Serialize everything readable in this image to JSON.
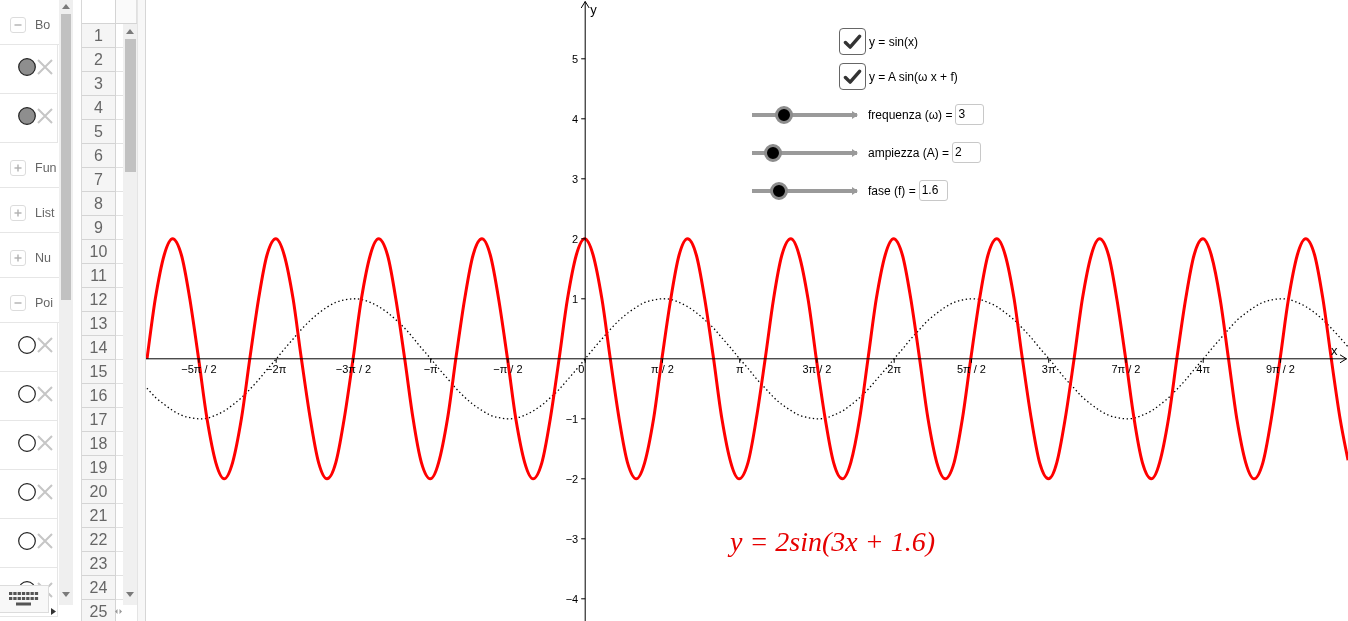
{
  "algebra": {
    "groups": [
      {
        "label": "Bo",
        "expanded": true,
        "items": [
          {
            "visible": true
          },
          {
            "visible": true
          }
        ]
      },
      {
        "label": "Fun",
        "expanded": false
      },
      {
        "label": "List",
        "expanded": false
      },
      {
        "label": "Nu",
        "expanded": false
      },
      {
        "label": "Poi",
        "expanded": true,
        "items": [
          {
            "visible": false
          },
          {
            "visible": false
          },
          {
            "visible": false
          },
          {
            "visible": false
          },
          {
            "visible": false
          },
          {
            "visible": false
          }
        ]
      }
    ]
  },
  "spreadsheet": {
    "row_numbers": [
      "1",
      "2",
      "3",
      "4",
      "5",
      "6",
      "7",
      "8",
      "9",
      "10",
      "11",
      "12",
      "13",
      "14",
      "15",
      "16",
      "17",
      "18",
      "19",
      "20",
      "21",
      "22",
      "23",
      "24",
      "25"
    ]
  },
  "graph": {
    "checkboxes": [
      {
        "label": "y = sin(x)",
        "checked": true
      },
      {
        "label": "y = A sin(ω x + f)",
        "checked": true
      }
    ],
    "sliders": [
      {
        "label": "frequenza (ω) =",
        "value": "3",
        "level": 0.3
      },
      {
        "label": "ampiezza (A) =",
        "value": "2",
        "level": 0.2
      },
      {
        "label": "fase (f) =",
        "value": "1.6",
        "level": 0.26
      }
    ],
    "formula": "y = 2sin(3x + 1.6)",
    "chart_data": {
      "type": "line",
      "xlabel": "x",
      "ylabel": "y",
      "xlim": [
        -8.93,
        15.51
      ],
      "ylim": [
        -4.37,
        5.98
      ],
      "xticks": [
        {
          "value": -7.854,
          "label": "−5π / 2"
        },
        {
          "value": -6.283,
          "label": "−2π"
        },
        {
          "value": -4.712,
          "label": "−3π / 2"
        },
        {
          "value": -3.142,
          "label": "−π"
        },
        {
          "value": -1.571,
          "label": "−π / 2"
        },
        {
          "value": 0,
          "label": "0"
        },
        {
          "value": 1.571,
          "label": "π / 2"
        },
        {
          "value": 3.142,
          "label": "π"
        },
        {
          "value": 4.712,
          "label": "3π / 2"
        },
        {
          "value": 6.283,
          "label": "2π"
        },
        {
          "value": 7.854,
          "label": "5π / 2"
        },
        {
          "value": 9.425,
          "label": "3π"
        },
        {
          "value": 10.996,
          "label": "7π / 2"
        },
        {
          "value": 12.566,
          "label": "4π"
        },
        {
          "value": 14.137,
          "label": "9π / 2"
        }
      ],
      "yticks": [
        {
          "value": -4,
          "label": "−4"
        },
        {
          "value": -3,
          "label": "−3"
        },
        {
          "value": -2,
          "label": "−2"
        },
        {
          "value": -1,
          "label": "−1"
        },
        {
          "value": 1,
          "label": "1"
        },
        {
          "value": 2,
          "label": "2"
        },
        {
          "value": 3,
          "label": "3"
        },
        {
          "value": 4,
          "label": "4"
        },
        {
          "value": 5,
          "label": "5"
        }
      ],
      "x": [
        -8.91,
        -8.74,
        -8.56,
        -8.39,
        -8.21,
        -8.04,
        -7.86,
        -7.69,
        -7.51,
        -7.34,
        -7.17,
        -6.99,
        -6.82,
        -6.64,
        -6.47,
        -6.29,
        -6.12,
        -5.94,
        -5.77,
        -5.59,
        -5.42,
        -5.25,
        -5.07,
        -4.9,
        -4.72,
        -4.55,
        -4.37,
        -4.2,
        -4.02,
        -3.85,
        -3.67,
        -3.5,
        -3.33,
        -3.15,
        -2.98,
        -2.8,
        -2.63,
        -2.45,
        -2.28,
        -2.1,
        -1.93,
        -1.76,
        -1.58,
        -1.41,
        -1.23,
        -1.06,
        -0.88,
        -0.71,
        -0.53,
        -0.36,
        -0.18,
        -0.01,
        0.16,
        0.34,
        0.51,
        0.69,
        0.86,
        1.04,
        1.21,
        1.39,
        1.56,
        1.74,
        1.91,
        2.08,
        2.26,
        2.43,
        2.61,
        2.78,
        2.96,
        3.13,
        3.31,
        3.48,
        3.66,
        3.83,
        4,
        4.18,
        4.35,
        4.53,
        4.7,
        4.88,
        5.05,
        5.23,
        5.4,
        5.58,
        5.75,
        5.92,
        6.1,
        6.27,
        6.45,
        6.62,
        6.8,
        6.97,
        7.15,
        7.32,
        7.5,
        7.67,
        7.84,
        8.02,
        8.19,
        8.37,
        8.54,
        8.72,
        8.89,
        9.07,
        9.24,
        9.42,
        9.59,
        9.76,
        9.94,
        10.11,
        10.29,
        10.46,
        10.64,
        10.81,
        10.99,
        11.16,
        11.33,
        11.51,
        11.68,
        11.86,
        12.03,
        12.21,
        12.38,
        12.56,
        12.73,
        12.91,
        13.08,
        13.25,
        13.43,
        13.6,
        13.78,
        13.95,
        14.13,
        14.3,
        14.48,
        14.65,
        14.83,
        15,
        15.17,
        15.35,
        15.51
      ],
      "series": [
        {
          "color": "#000000",
          "line_style": "dotted",
          "values": [
            -0.49,
            -0.64,
            -0.76,
            -0.86,
            -0.94,
            -0.98,
            -1,
            -0.99,
            -0.94,
            -0.87,
            -0.77,
            -0.65,
            -0.51,
            -0.35,
            -0.18,
            -0.01,
            0.16,
            0.33,
            0.49,
            0.64,
            0.76,
            0.86,
            0.94,
            0.98,
            1,
            0.99,
            0.94,
            0.87,
            0.77,
            0.65,
            0.51,
            0.35,
            0.18,
            0.01,
            -0.16,
            -0.33,
            -0.49,
            -0.64,
            -0.76,
            -0.86,
            -0.94,
            -0.98,
            -1,
            -0.99,
            -0.94,
            -0.87,
            -0.77,
            -0.65,
            -0.51,
            -0.35,
            -0.18,
            -0.01,
            0.16,
            0.33,
            0.49,
            0.64,
            0.76,
            0.86,
            0.94,
            0.98,
            1,
            0.99,
            0.94,
            0.87,
            0.77,
            0.65,
            0.51,
            0.35,
            0.18,
            0.01,
            -0.16,
            -0.33,
            -0.49,
            -0.64,
            -0.76,
            -0.86,
            -0.94,
            -0.98,
            -1,
            -0.99,
            -0.94,
            -0.87,
            -0.77,
            -0.65,
            -0.51,
            -0.35,
            -0.18,
            -0.01,
            0.16,
            0.33,
            0.49,
            0.64,
            0.76,
            0.86,
            0.94,
            0.98,
            1,
            0.99,
            0.94,
            0.87,
            0.77,
            0.65,
            0.51,
            0.35,
            0.18,
            0.01,
            -0.16,
            -0.33,
            -0.49,
            -0.64,
            -0.76,
            -0.86,
            -0.94,
            -0.98,
            -1,
            -0.99,
            -0.94,
            -0.87,
            -0.77,
            -0.65,
            -0.51,
            -0.35,
            -0.18,
            -0.01,
            0.16,
            0.33,
            0.49,
            0.64,
            0.76,
            0.86,
            0.94,
            0.98,
            1,
            0.99,
            0.94,
            0.87,
            0.77,
            0.65,
            0.51,
            0.35,
            0.2
          ]
        },
        {
          "color": "#ff0000",
          "line_style": "solid",
          "values": [
            0,
            1,
            1.73,
            2,
            1.73,
            1,
            0,
            -1,
            -1.73,
            -2,
            -1.73,
            -1,
            0,
            1,
            1.73,
            2,
            1.73,
            1,
            0,
            -1,
            -1.73,
            -2,
            -1.73,
            -1,
            0,
            1,
            1.73,
            2,
            1.73,
            1,
            0,
            -1,
            -1.73,
            -2,
            -1.73,
            -1,
            0,
            1,
            1.73,
            2,
            1.73,
            1,
            0,
            -1,
            -1.73,
            -2,
            -1.73,
            -1,
            0,
            1,
            1.73,
            2,
            1.73,
            1,
            0,
            -1,
            -1.73,
            -2,
            -1.73,
            -1,
            0,
            1,
            1.73,
            2,
            1.73,
            1,
            0,
            -1,
            -1.73,
            -2,
            -1.73,
            -1,
            0,
            1,
            1.73,
            2,
            1.73,
            1,
            0,
            -1,
            -1.73,
            -2,
            -1.73,
            -1,
            0,
            1,
            1.73,
            2,
            1.73,
            1,
            0,
            -1,
            -1.73,
            -2,
            -1.73,
            -1,
            0,
            1,
            1.73,
            2,
            1.73,
            1,
            0,
            -1,
            -1.73,
            -2,
            -1.73,
            -1,
            0,
            1,
            1.73,
            2,
            1.73,
            1,
            0,
            -1,
            -1.73,
            -2,
            -1.73,
            -1,
            0,
            1,
            1.73,
            2,
            1.73,
            1,
            0,
            -1,
            -1.73,
            -2,
            -1.73,
            -1,
            0,
            1,
            1.73,
            2,
            1.73,
            1,
            0,
            -1,
            -1.69
          ]
        }
      ]
    }
  }
}
